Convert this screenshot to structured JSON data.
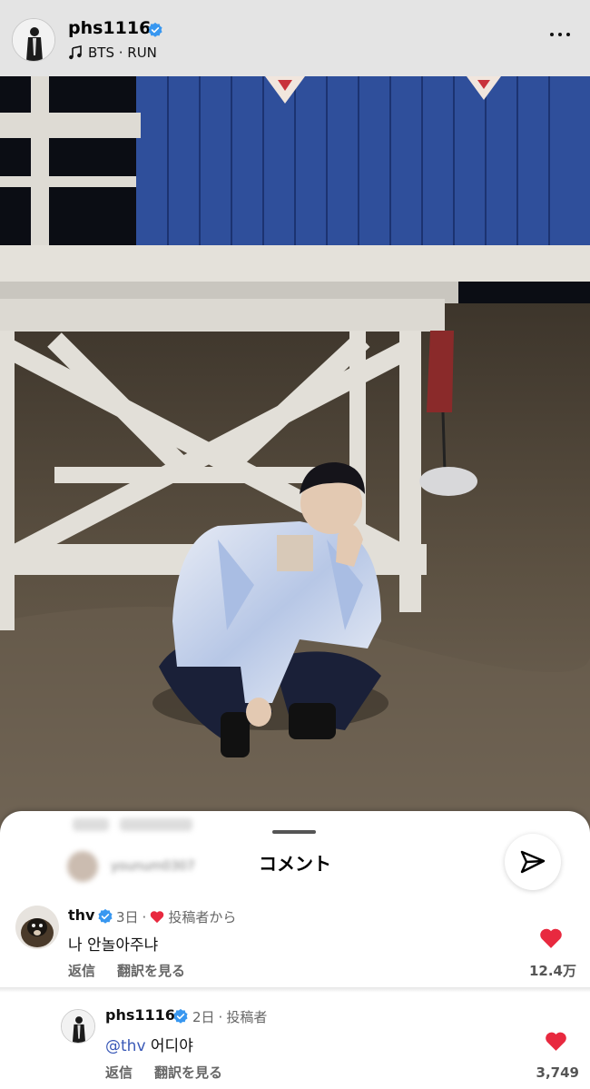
{
  "post": {
    "username": "phs1116",
    "music": "BTS · RUN"
  },
  "comments_sheet": {
    "title": "コメント",
    "blurred_row": "younum0307"
  },
  "comments": [
    {
      "username": "thv",
      "time": "3日",
      "separator": "·",
      "author_like_label": "投稿者から",
      "text": "나 안놀아주냐",
      "reply_label": "返信",
      "translate_label": "翻訳を見る",
      "like_count": "12.4万"
    },
    {
      "username": "phs1116",
      "time": "2日",
      "separator": "·",
      "author_tag": "投稿者",
      "mention": "@thv",
      "text": "어디야",
      "reply_label": "返信",
      "translate_label": "翻訳を見る",
      "like_count": "3,749"
    }
  ],
  "colors": {
    "verified": "#3897f0",
    "heart": "#e8293f",
    "mention": "#3a59b7"
  }
}
